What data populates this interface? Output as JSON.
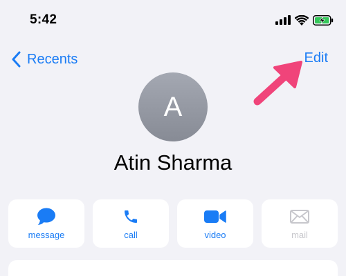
{
  "status_bar": {
    "time": "5:42",
    "icons": [
      "cellular-signal-icon",
      "wifi-icon",
      "battery-charging-icon"
    ]
  },
  "nav": {
    "back_label": "Recents",
    "edit_label": "Edit"
  },
  "contact": {
    "initial": "A",
    "name": "Atin Sharma"
  },
  "actions": [
    {
      "label": "message",
      "icon": "message-bubble-icon",
      "enabled": true
    },
    {
      "label": "call",
      "icon": "phone-icon",
      "enabled": true
    },
    {
      "label": "video",
      "icon": "video-camera-icon",
      "enabled": true
    },
    {
      "label": "mail",
      "icon": "envelope-icon",
      "enabled": false
    }
  ],
  "colors": {
    "accent": "#1a7cf5",
    "background": "#f2f2f7",
    "card": "#ffffff",
    "disabled": "#c7c7cc",
    "annotation": "#f0447a",
    "battery": "#34c759"
  }
}
